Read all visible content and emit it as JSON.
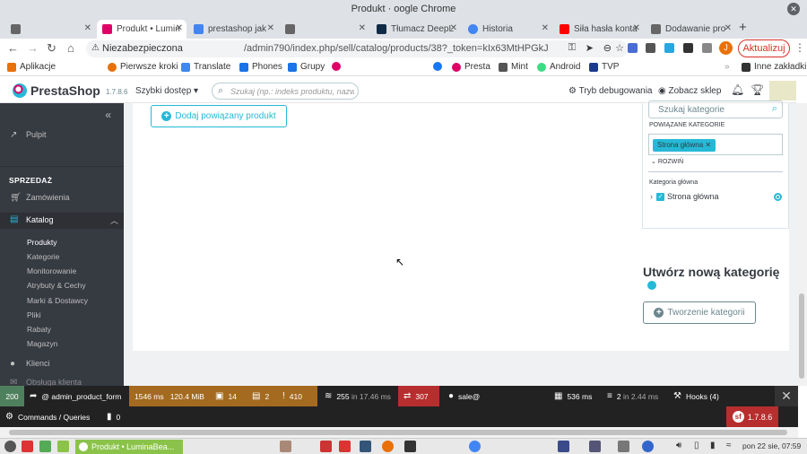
{
  "window": {
    "title_left": "Produkt",
    "title_right": "oogle Chrome"
  },
  "tabs": [
    {
      "label": "",
      "favicon": "#666"
    },
    {
      "label": "Produkt • Lumin",
      "favicon": "#df0067",
      "active": true
    },
    {
      "label": "prestashop jak",
      "favicon": "#4285f4"
    },
    {
      "label": "",
      "favicon": "#666"
    },
    {
      "label": "Tłumacz DeepL",
      "favicon": "#0f2b46"
    },
    {
      "label": "Historia",
      "favicon": "#4285f4"
    },
    {
      "label": "Siła hasła konta",
      "favicon": "#ff0000"
    },
    {
      "label": "Dodawanie pro",
      "favicon": "#666"
    }
  ],
  "address": {
    "security": "Niezabezpieczona",
    "url": "/admin790/index.php/sell/catalog/products/38?_token=kIx63MtHPGkJGPWyiFoh...",
    "update_label": "Aktualizuj",
    "profile_initial": "J"
  },
  "bookmarks": {
    "apps": "Aplikacje",
    "items": [
      "Pierwsze kroki",
      "Translate",
      "Phones",
      "Grupy",
      "",
      "",
      "Presta",
      "Mint",
      "Android",
      "TVP"
    ],
    "other": "Inne zakładki"
  },
  "ps_header": {
    "logo": "PrestaShop",
    "version": "1.7.8.6",
    "quick_access": "Szybki dostęp",
    "search_placeholder": "Szukaj (np.: indeks produktu, nazwa kl",
    "debug_mode": "Tryb debugowania",
    "view_shop": "Zobacz sklep"
  },
  "sidebar": {
    "collapse": "«",
    "pulpit": "Pulpit",
    "section": "SPRZEDAŻ",
    "orders": "Zamówienia",
    "catalog": "Katalog",
    "catalog_sub": [
      "Produkty",
      "Kategorie",
      "Monitorowanie",
      "Atrybuty & Cechy",
      "Marki & Dostawcy",
      "Pliki",
      "Rabaty",
      "Magazyn"
    ],
    "customers": "Klienci",
    "next": "Obsługa klienta"
  },
  "main": {
    "add_related": "Dodaj powiązany produkt",
    "cat_search_placeholder": "Szukaj kategorie",
    "assoc_label": "POWIĄZANE KATEGORIE",
    "assoc_tag": "Strona główna",
    "expand": "ROZWIŃ",
    "main_cat_label": "Kategoria główna",
    "tree_item": "Strona główna",
    "new_cat_title": "Utwórz nową kategorię",
    "create_btn": "Tworzenie kategorii"
  },
  "debug": {
    "status": "200",
    "route": "@ admin_product_form",
    "time": "1546 ms",
    "memory": "120.4 MiB",
    "forms": "14",
    "twig": "2",
    "logs": "410",
    "db": "255",
    "db_in": "in 17.46 ms",
    "translation": "307",
    "user": "sale@",
    "perf": "536 ms",
    "cache": "2",
    "cache_in": "in 2.44 ms",
    "hooks": "Hooks (4)",
    "commands": "Commands / Queries",
    "commands_count": "0",
    "sf_version": "1.7.8.6",
    "colors": {
      "time": "#a46a1f",
      "logs": "#a46a1f",
      "translation": "#b72e2e"
    }
  },
  "taskbar": {
    "window": "Produkt • LuminaBea...",
    "clock": "pon 22 sie, 07:59"
  }
}
